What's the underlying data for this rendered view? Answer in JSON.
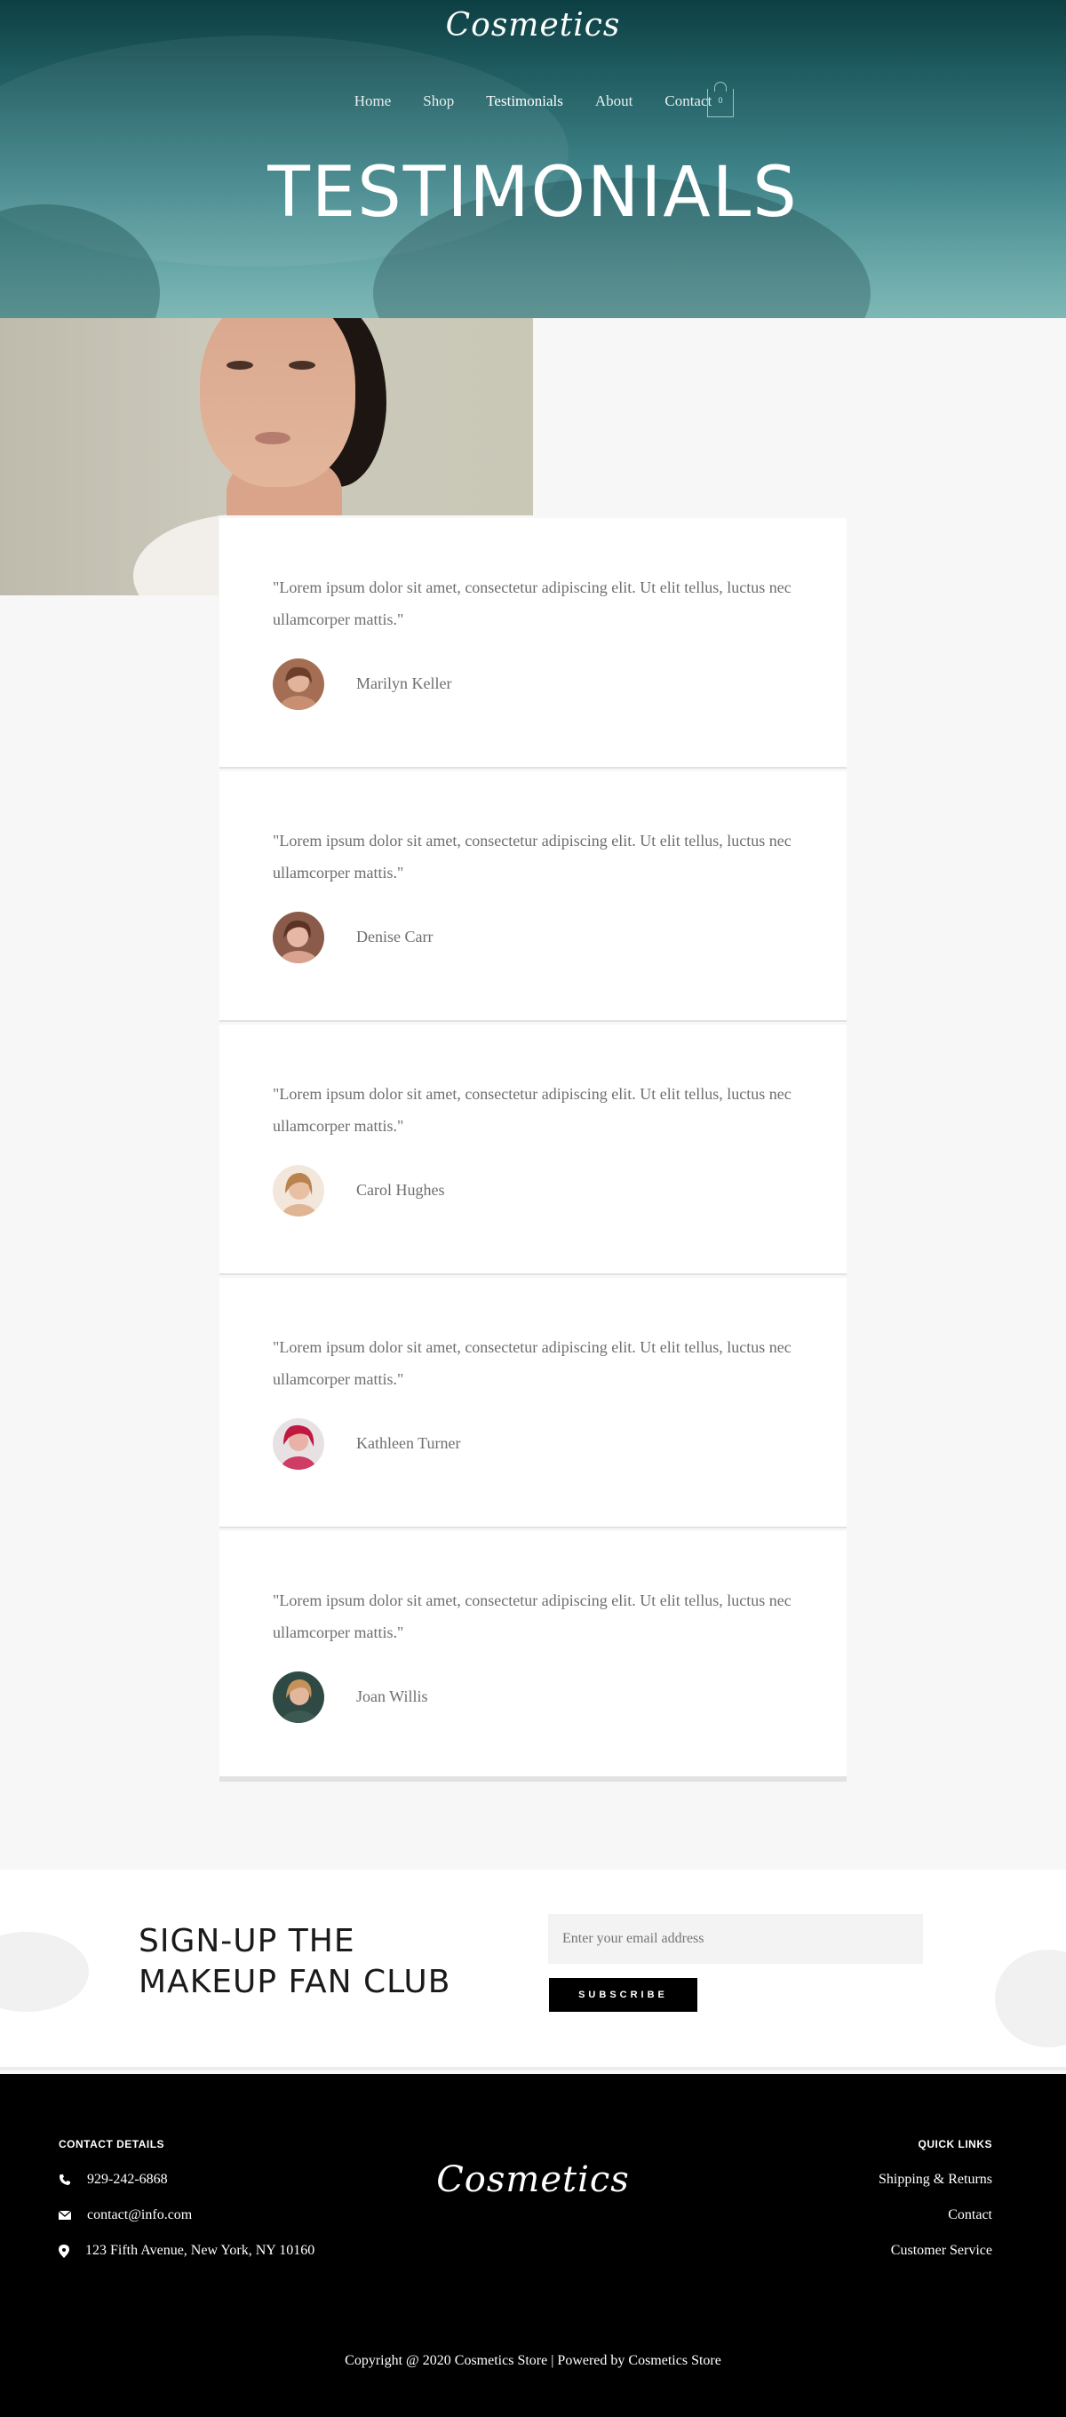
{
  "header": {
    "logo_text": "Cosmetics",
    "nav": [
      {
        "label": "Home"
      },
      {
        "label": "Shop"
      },
      {
        "label": "Testimonials"
      },
      {
        "label": "About"
      },
      {
        "label": "Contact"
      }
    ],
    "cart_count": "0",
    "page_title": "TESTIMONIALS",
    "colors": {
      "hero_top": "#0c3f42",
      "hero_bottom": "#7eb8b6"
    }
  },
  "testimonials": [
    {
      "quote": "\"Lorem ipsum dolor sit amet, consectetur adipiscing elit. Ut elit tellus, luctus nec ullamcorper mattis.\"",
      "name": "Marilyn Keller"
    },
    {
      "quote": "\"Lorem ipsum dolor sit amet, consectetur adipiscing elit. Ut elit tellus, luctus nec ullamcorper mattis.\"",
      "name": "Denise Carr"
    },
    {
      "quote": "\"Lorem ipsum dolor sit amet, consectetur adipiscing elit. Ut elit tellus, luctus nec ullamcorper mattis.\"",
      "name": "Carol Hughes"
    },
    {
      "quote": "\"Lorem ipsum dolor sit amet, consectetur adipiscing elit. Ut elit tellus, luctus nec ullamcorper mattis.\"",
      "name": "Kathleen Turner"
    },
    {
      "quote": "\"Lorem ipsum dolor sit amet, consectetur adipiscing elit. Ut elit tellus, luctus nec ullamcorper mattis.\"",
      "name": "Joan Willis"
    }
  ],
  "signup": {
    "title_line1": "SIGN-UP THE",
    "title_line2": "MAKEUP FAN CLUB",
    "email_placeholder": "Enter your email address",
    "button_label": "SUBSCRIBE"
  },
  "footer": {
    "contact_heading": "CONTACT DETAILS",
    "phone": "929-242-6868",
    "email": "contact@info.com",
    "address": "123 Fifth Avenue, New York, NY 10160",
    "logo_text": "Cosmetics",
    "links_heading": "QUICK LINKS",
    "links": [
      {
        "label": "Shipping & Returns"
      },
      {
        "label": "Contact"
      },
      {
        "label": "Customer Service"
      }
    ],
    "copyright": "Copyright @ 2020 Cosmetics Store | Powered by Cosmetics Store"
  }
}
